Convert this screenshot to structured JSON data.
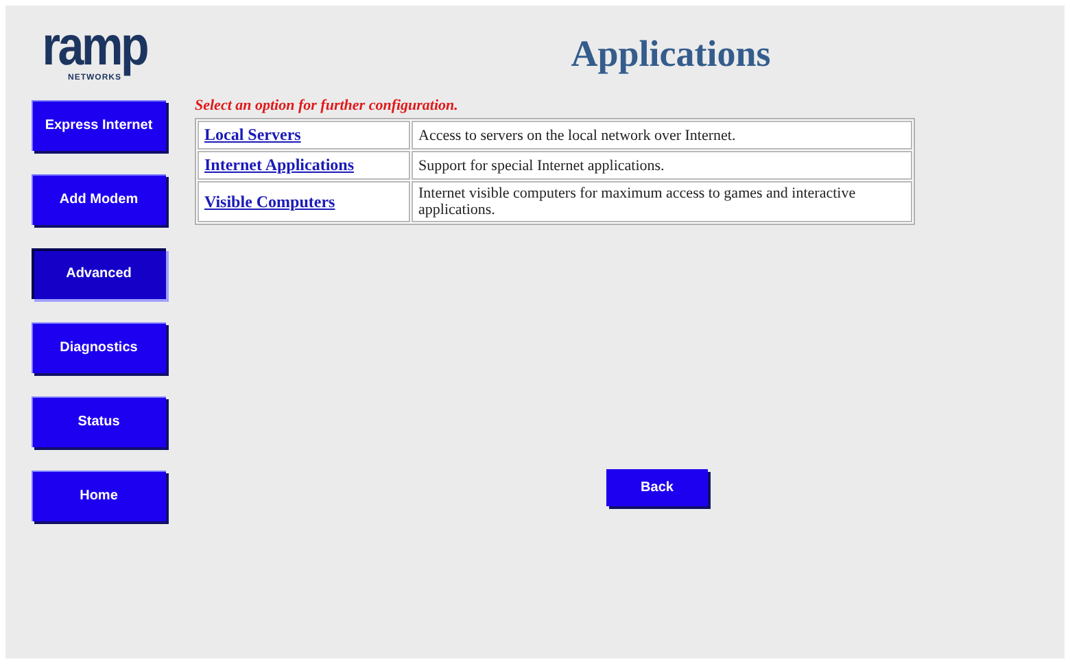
{
  "logo": {
    "name": "ramp",
    "subtitle": "NETWORKS"
  },
  "nav": [
    {
      "label": "Express Internet",
      "selected": false
    },
    {
      "label": "Add Modem",
      "selected": false
    },
    {
      "label": "Advanced",
      "selected": true
    },
    {
      "label": "Diagnostics",
      "selected": false
    },
    {
      "label": "Status",
      "selected": false
    },
    {
      "label": "Home",
      "selected": false
    }
  ],
  "title": "Applications",
  "instruction": "Select an option for further configuration.",
  "options": [
    {
      "link": "Local Servers",
      "description": "Access to servers on the local network over Internet."
    },
    {
      "link": "Internet Applications",
      "description": "Support for special Internet applications."
    },
    {
      "link": "Visible Computers",
      "description": "Internet visible computers for maximum access to games and interactive applications."
    }
  ],
  "back_button": "Back"
}
